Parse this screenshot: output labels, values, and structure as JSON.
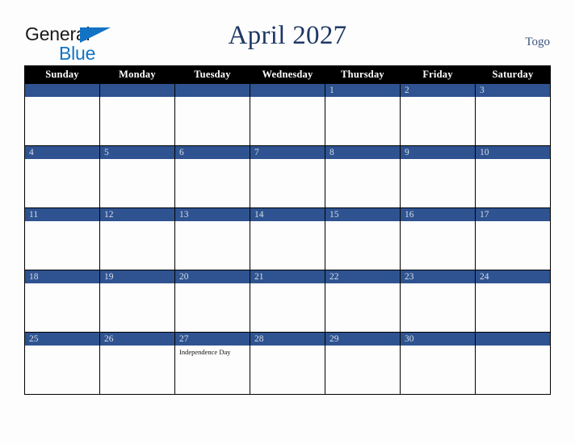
{
  "brand": {
    "line1": "General",
    "line2": "Blue",
    "triangle_color": "#1273c4",
    "text_color": "#1a1a1a"
  },
  "header": {
    "title": "April 2027",
    "country": "Togo",
    "title_color": "#1f3864"
  },
  "colors": {
    "header_row_bg": "#000000",
    "header_row_text": "#ffffff",
    "date_bar_bg": "#2e5390",
    "date_bar_text": "#d9dde8",
    "cell_bg": "#fdfdfd",
    "page_bg": "#fdfdfd",
    "grid_line": "#000000"
  },
  "weekdays": [
    "Sunday",
    "Monday",
    "Tuesday",
    "Wednesday",
    "Thursday",
    "Friday",
    "Saturday"
  ],
  "weeks": [
    [
      {
        "date": "",
        "events": []
      },
      {
        "date": "",
        "events": []
      },
      {
        "date": "",
        "events": []
      },
      {
        "date": "",
        "events": []
      },
      {
        "date": "1",
        "events": []
      },
      {
        "date": "2",
        "events": []
      },
      {
        "date": "3",
        "events": []
      }
    ],
    [
      {
        "date": "4",
        "events": []
      },
      {
        "date": "5",
        "events": []
      },
      {
        "date": "6",
        "events": []
      },
      {
        "date": "7",
        "events": []
      },
      {
        "date": "8",
        "events": []
      },
      {
        "date": "9",
        "events": []
      },
      {
        "date": "10",
        "events": []
      }
    ],
    [
      {
        "date": "11",
        "events": []
      },
      {
        "date": "12",
        "events": []
      },
      {
        "date": "13",
        "events": []
      },
      {
        "date": "14",
        "events": []
      },
      {
        "date": "15",
        "events": []
      },
      {
        "date": "16",
        "events": []
      },
      {
        "date": "17",
        "events": []
      }
    ],
    [
      {
        "date": "18",
        "events": []
      },
      {
        "date": "19",
        "events": []
      },
      {
        "date": "20",
        "events": []
      },
      {
        "date": "21",
        "events": []
      },
      {
        "date": "22",
        "events": []
      },
      {
        "date": "23",
        "events": []
      },
      {
        "date": "24",
        "events": []
      }
    ],
    [
      {
        "date": "25",
        "events": []
      },
      {
        "date": "26",
        "events": []
      },
      {
        "date": "27",
        "events": [
          "Independence Day"
        ]
      },
      {
        "date": "28",
        "events": []
      },
      {
        "date": "29",
        "events": []
      },
      {
        "date": "30",
        "events": []
      },
      {
        "date": "",
        "events": []
      }
    ]
  ]
}
